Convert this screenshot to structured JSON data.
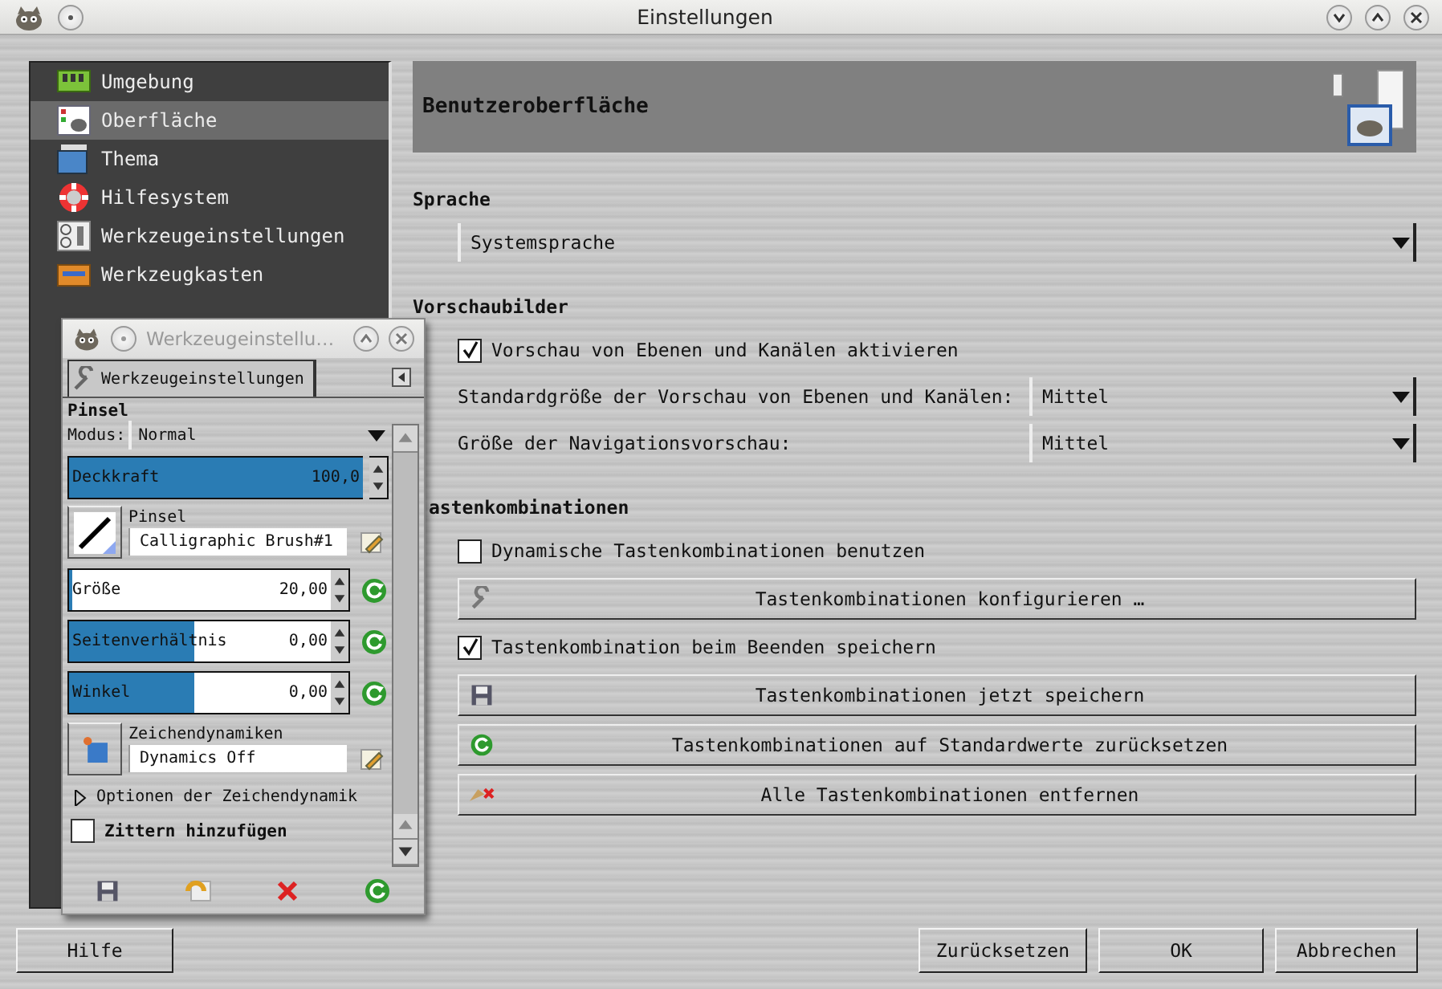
{
  "window": {
    "title": "Einstellungen"
  },
  "sidebar": {
    "items": [
      {
        "label": "Umgebung",
        "selected": false
      },
      {
        "label": "Oberfläche",
        "selected": true
      },
      {
        "label": "Thema",
        "selected": false
      },
      {
        "label": "Hilfesystem",
        "selected": false
      },
      {
        "label": "Werkzeugeinstellungen",
        "selected": false
      },
      {
        "label": "Werkzeugkasten",
        "selected": false
      }
    ]
  },
  "page": {
    "title": "Benutzeroberfläche"
  },
  "sections": [
    {
      "heading": "Sprache",
      "rows": [
        {
          "kind": "combo",
          "value": "Systemsprache"
        }
      ]
    },
    {
      "heading": "Vorschaubilder",
      "rows": [
        {
          "kind": "checkbox",
          "label": "Vorschau von Ebenen und Kanälen aktivieren",
          "checked": true
        },
        {
          "kind": "combo",
          "label": "Standardgröße der Vorschau von Ebenen und Kanälen:",
          "value": "Mittel"
        },
        {
          "kind": "combo",
          "label": "Größe der Navigationsvorschau:",
          "value": "Mittel"
        }
      ]
    },
    {
      "heading": "astenkombinationen",
      "rows": [
        {
          "kind": "checkbox",
          "label": "Dynamische Tastenkombinationen benutzen",
          "checked": false
        },
        {
          "kind": "button",
          "label": "Tastenkombinationen konfigurieren …"
        },
        {
          "kind": "checkbox",
          "label": "Tastenkombination beim Beenden speichern",
          "checked": true
        },
        {
          "kind": "button",
          "label": "Tastenkombinationen jetzt speichern"
        },
        {
          "kind": "button",
          "label": "Tastenkombinationen auf Standardwerte zurücksetzen"
        },
        {
          "kind": "button",
          "label": "Alle Tastenkombinationen entfernen"
        }
      ]
    }
  ],
  "buttons": {
    "left": [
      "Hilfe"
    ],
    "right": [
      "Zurücksetzen",
      "OK",
      "Abbrechen"
    ]
  },
  "tool_options": {
    "title": "Werkzeugeinstellu…",
    "tab": "Werkzeugeinstellungen",
    "tool": "Pinsel",
    "mode": {
      "label": "Modus:",
      "value": "Normal"
    },
    "opacity": {
      "label": "Deckkraft",
      "reading": "100,0",
      "level": 1
    },
    "brush": {
      "label": "Pinsel",
      "value": "Calligraphic Brush#1"
    },
    "sliders": [
      {
        "label": "Größe",
        "reading": "20,00",
        "level": 0.01
      },
      {
        "label": "Seitenverhältnis",
        "reading": "0,00",
        "level": 0.48
      },
      {
        "label": "Winkel",
        "reading": "0,00",
        "level": 0.48
      }
    ],
    "dynamics": {
      "label": "Zeichendynamiken",
      "value": "Dynamics Off"
    },
    "expander": {
      "label": "Optionen der Zeichendynamik",
      "expanded": false
    },
    "jitter": {
      "label": "Zittern hinzufügen",
      "checked": false
    }
  }
}
